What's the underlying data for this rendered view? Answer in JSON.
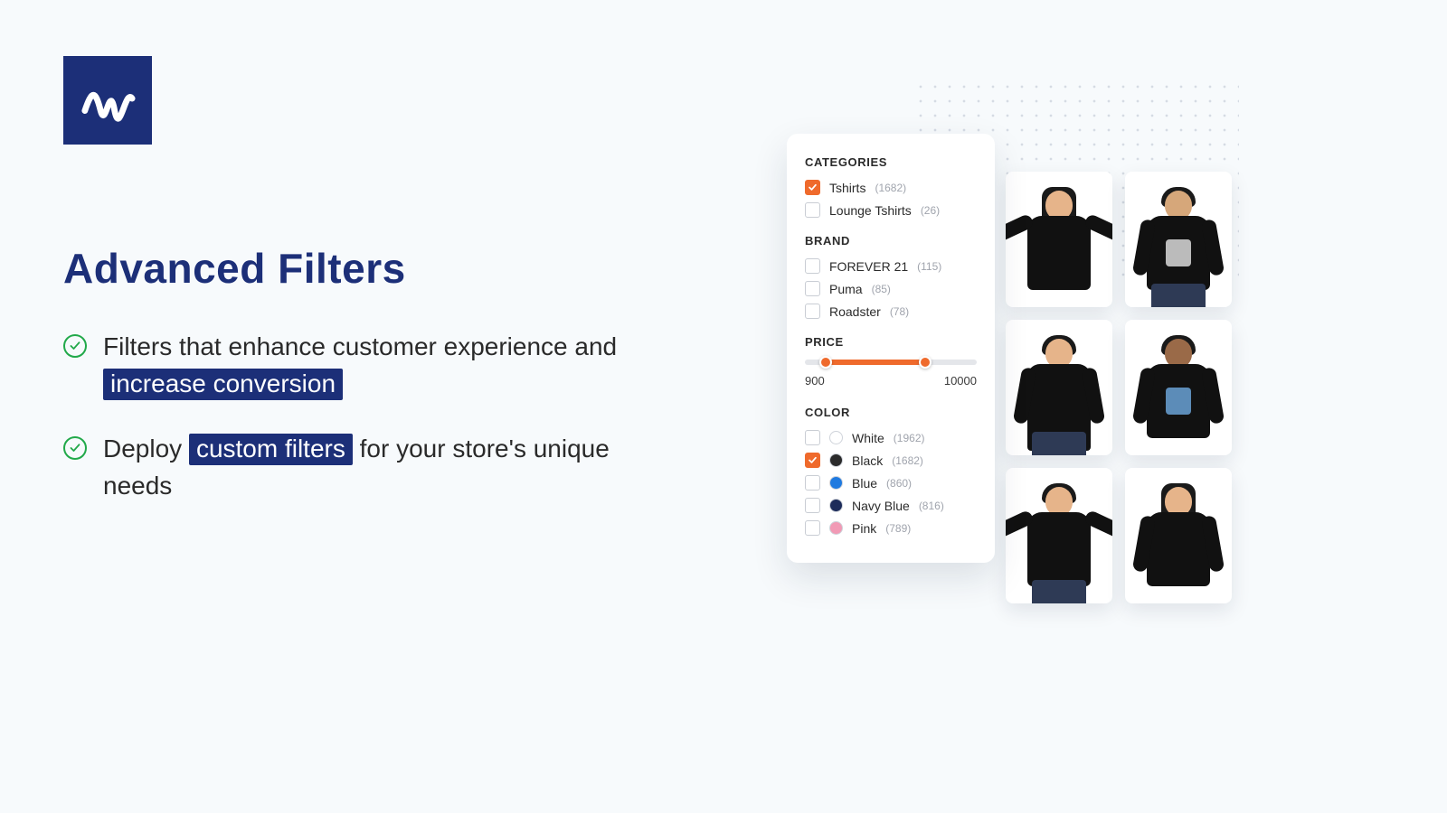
{
  "heading": "Advanced Filters",
  "bullets": [
    {
      "pre": "Filters that enhance customer experience and ",
      "hl": "increase conversion",
      "post": ""
    },
    {
      "pre": "Deploy ",
      "hl": "custom filters",
      "post": " for your store's unique needs"
    }
  ],
  "panel": {
    "categories": {
      "title": "CATEGORIES",
      "items": [
        {
          "label": "Tshirts",
          "count": "(1682)",
          "checked": true
        },
        {
          "label": "Lounge Tshirts",
          "count": "(26)",
          "checked": false
        }
      ]
    },
    "brand": {
      "title": "BRAND",
      "items": [
        {
          "label": "FOREVER 21",
          "count": "(115)",
          "checked": false
        },
        {
          "label": "Puma",
          "count": "(85)",
          "checked": false
        },
        {
          "label": "Roadster",
          "count": "(78)",
          "checked": false
        }
      ]
    },
    "price": {
      "title": "PRICE",
      "min": "900",
      "max": "10000"
    },
    "color": {
      "title": "COLOR",
      "items": [
        {
          "label": "White",
          "count": "(1962)",
          "checked": false,
          "swatch": "#ffffff"
        },
        {
          "label": "Black",
          "count": "(1682)",
          "checked": true,
          "swatch": "#2b2b2b"
        },
        {
          "label": "Blue",
          "count": "(860)",
          "checked": false,
          "swatch": "#1f7ae0"
        },
        {
          "label": "Navy Blue",
          "count": "(816)",
          "checked": false,
          "swatch": "#1d2c5a"
        },
        {
          "label": "Pink",
          "count": "(789)",
          "checked": false,
          "swatch": "#f19ab5"
        }
      ]
    }
  }
}
